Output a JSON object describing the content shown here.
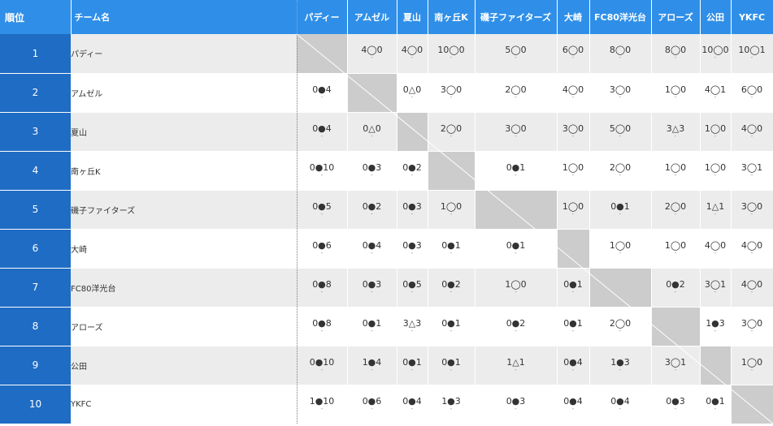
{
  "header": {
    "rank_label": "順位",
    "team_label": "チーム名"
  },
  "colors": {
    "header_bg": "#2f8fe8",
    "rank_bg": "#1f6cc4",
    "self_cell": "#cccccc",
    "row_alt": "#ececec"
  },
  "teams": [
    "パディー",
    "アムゼル",
    "夏山",
    "南ヶ丘K",
    "磯子ファイターズ",
    "大崎",
    "FC80洋光台",
    "アローズ",
    "公田",
    "YKFC"
  ],
  "rows": [
    {
      "rank": "1",
      "team": "パディー",
      "cells": [
        "",
        "4◯0",
        "4◯0",
        "10◯0",
        "5◯0",
        "6◯0",
        "8◯0",
        "8◯0",
        "10◯0",
        "10◯1"
      ]
    },
    {
      "rank": "2",
      "team": "アムゼル",
      "cells": [
        "0●4",
        "",
        "0△0",
        "3◯0",
        "2◯0",
        "4◯0",
        "3◯0",
        "1◯0",
        "4◯1",
        "6◯0"
      ]
    },
    {
      "rank": "3",
      "team": "夏山",
      "cells": [
        "0●4",
        "0△0",
        "",
        "2◯0",
        "3◯0",
        "3◯0",
        "5◯0",
        "3△3",
        "1◯0",
        "4◯0"
      ]
    },
    {
      "rank": "4",
      "team": "南ヶ丘K",
      "cells": [
        "0●10",
        "0●3",
        "0●2",
        "",
        "0●1",
        "1◯0",
        "2◯0",
        "1◯0",
        "1◯0",
        "3◯1"
      ]
    },
    {
      "rank": "5",
      "team": "磯子ファイターズ",
      "cells": [
        "0●5",
        "0●2",
        "0●3",
        "1◯0",
        "",
        "1◯0",
        "0●1",
        "2◯0",
        "1△1",
        "3◯0"
      ]
    },
    {
      "rank": "6",
      "team": "大崎",
      "cells": [
        "0●6",
        "0●4",
        "0●3",
        "0●1",
        "0●1",
        "",
        "1◯0",
        "1◯0",
        "4◯0",
        "4◯0"
      ]
    },
    {
      "rank": "7",
      "team": "FC80洋光台",
      "cells": [
        "0●8",
        "0●3",
        "0●5",
        "0●2",
        "1◯0",
        "0●1",
        "",
        "0●2",
        "3◯1",
        "4◯0"
      ]
    },
    {
      "rank": "8",
      "team": "アローズ",
      "cells": [
        "0●8",
        "0●1",
        "3△3",
        "0●1",
        "0●2",
        "0●1",
        "2◯0",
        "",
        "1●3",
        "3◯0"
      ]
    },
    {
      "rank": "9",
      "team": "公田",
      "cells": [
        "0●10",
        "1●4",
        "0●1",
        "0●1",
        "1△1",
        "0●4",
        "1●3",
        "3◯1",
        "",
        "1◯0"
      ]
    },
    {
      "rank": "10",
      "team": "YKFC",
      "cells": [
        "1●10",
        "0●6",
        "0●4",
        "1●3",
        "0●3",
        "0●4",
        "0●4",
        "0●3",
        "0●1",
        ""
      ]
    }
  ],
  "sub_mark": "-"
}
